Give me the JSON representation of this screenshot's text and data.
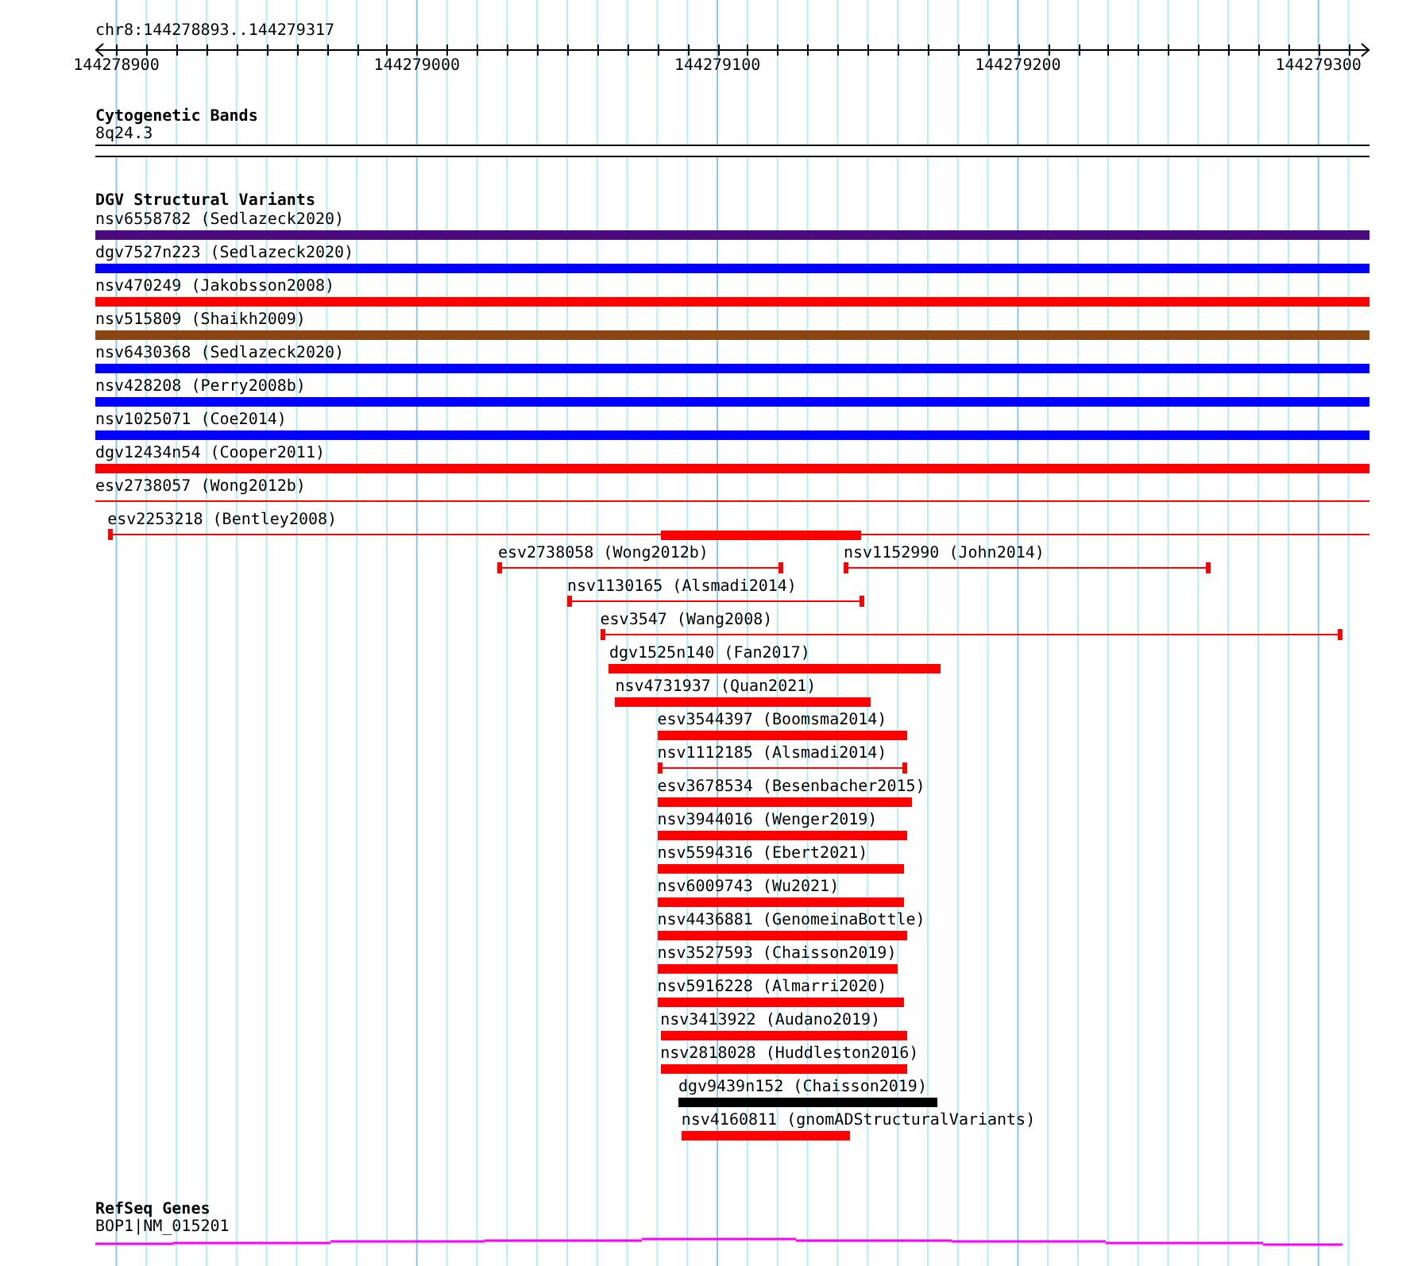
{
  "ruler": {
    "location": "chr8:144278893..144279317",
    "ticks": [
      "144278900",
      "144279000",
      "144279100",
      "144279200",
      "144279300"
    ]
  },
  "cytoband_track": {
    "title": "Cytogenetic Bands",
    "band": "8q24.3"
  },
  "dgv_track": {
    "title": "DGV Structural Variants",
    "rows": [
      {
        "features": [
          {
            "label": "nsv6558782 (Sedlazeck2020)",
            "kind": "thick",
            "color": "#4b0a7d"
          }
        ]
      },
      {
        "features": [
          {
            "label": "dgv7527n223 (Sedlazeck2020)",
            "kind": "thick",
            "color": "#0000ff"
          }
        ]
      },
      {
        "features": [
          {
            "label": "nsv470249 (Jakobsson2008)",
            "kind": "thick",
            "color": "#ff0000"
          }
        ]
      },
      {
        "features": [
          {
            "label": "nsv515809 (Shaikh2009)",
            "kind": "thick",
            "color": "#8b4513"
          }
        ]
      },
      {
        "features": [
          {
            "label": "nsv6430368 (Sedlazeck2020)",
            "kind": "thick",
            "color": "#0000ff"
          }
        ]
      },
      {
        "features": [
          {
            "label": "nsv428208 (Perry2008b)",
            "kind": "thick",
            "color": "#0000ff"
          }
        ]
      },
      {
        "features": [
          {
            "label": "nsv1025071 (Coe2014)",
            "kind": "thick",
            "color": "#0000ff"
          }
        ]
      },
      {
        "features": [
          {
            "label": "dgv12434n54 (Cooper2011)",
            "kind": "thick",
            "color": "#ff0000"
          }
        ]
      },
      {
        "features": [
          {
            "label": "esv2738057 (Wong2012b)",
            "kind": "thin",
            "color": "#ff0000"
          }
        ]
      },
      {
        "features": [
          {
            "label": "esv2253218 (Bentley2008)",
            "kind": "thin",
            "color": "#ff0000"
          }
        ]
      },
      {
        "features": [
          {
            "label": "esv2738058 (Wong2012b)",
            "kind": "thin",
            "color": "#ff0000"
          },
          {
            "label": "nsv1152990 (John2014)",
            "kind": "thin",
            "color": "#ff0000"
          }
        ]
      },
      {
        "features": [
          {
            "label": "nsv1130165 (Alsmadi2014)",
            "kind": "thin",
            "color": "#ff0000"
          }
        ]
      },
      {
        "features": [
          {
            "label": "esv3547 (Wang2008)",
            "kind": "thin",
            "color": "#ff0000"
          }
        ]
      },
      {
        "features": [
          {
            "label": "dgv1525n140 (Fan2017)",
            "kind": "thick",
            "color": "#ff0000"
          }
        ]
      },
      {
        "features": [
          {
            "label": "nsv4731937 (Quan2021)",
            "kind": "thick",
            "color": "#ff0000"
          }
        ]
      },
      {
        "features": [
          {
            "label": "esv3544397 (Boomsma2014)",
            "kind": "thick",
            "color": "#ff0000"
          }
        ]
      },
      {
        "features": [
          {
            "label": "nsv1112185 (Alsmadi2014)",
            "kind": "thin",
            "color": "#ff0000"
          }
        ]
      },
      {
        "features": [
          {
            "label": "esv3678534 (Besenbacher2015)",
            "kind": "thick",
            "color": "#ff0000"
          }
        ]
      },
      {
        "features": [
          {
            "label": "nsv3944016 (Wenger2019)",
            "kind": "thick",
            "color": "#ff0000"
          }
        ]
      },
      {
        "features": [
          {
            "label": "nsv5594316 (Ebert2021)",
            "kind": "thick",
            "color": "#ff0000"
          }
        ]
      },
      {
        "features": [
          {
            "label": "nsv6009743 (Wu2021)",
            "kind": "thick",
            "color": "#ff0000"
          }
        ]
      },
      {
        "features": [
          {
            "label": "nsv4436881 (GenomeinaBottle)",
            "kind": "thick",
            "color": "#ff0000"
          }
        ]
      },
      {
        "features": [
          {
            "label": "nsv3527593 (Chaisson2019)",
            "kind": "thick",
            "color": "#ff0000"
          }
        ]
      },
      {
        "features": [
          {
            "label": "nsv5916228 (Almarri2020)",
            "kind": "thick",
            "color": "#ff0000"
          }
        ]
      },
      {
        "features": [
          {
            "label": "nsv3413922 (Audano2019)",
            "kind": "thick",
            "color": "#ff0000"
          }
        ]
      },
      {
        "features": [
          {
            "label": "nsv2818028 (Huddleston2016)",
            "kind": "thick",
            "color": "#ff0000"
          }
        ]
      },
      {
        "features": [
          {
            "label": "dgv9439n152 (Chaisson2019)",
            "kind": "thick",
            "color": "#000000"
          }
        ]
      },
      {
        "features": [
          {
            "label": "nsv4160811 (gnomADStructuralVariants)",
            "kind": "thick",
            "color": "#ff0000"
          }
        ]
      }
    ]
  },
  "refseq_track": {
    "title": "RefSeq Genes",
    "gene": "BOP1|NM_015201"
  }
}
